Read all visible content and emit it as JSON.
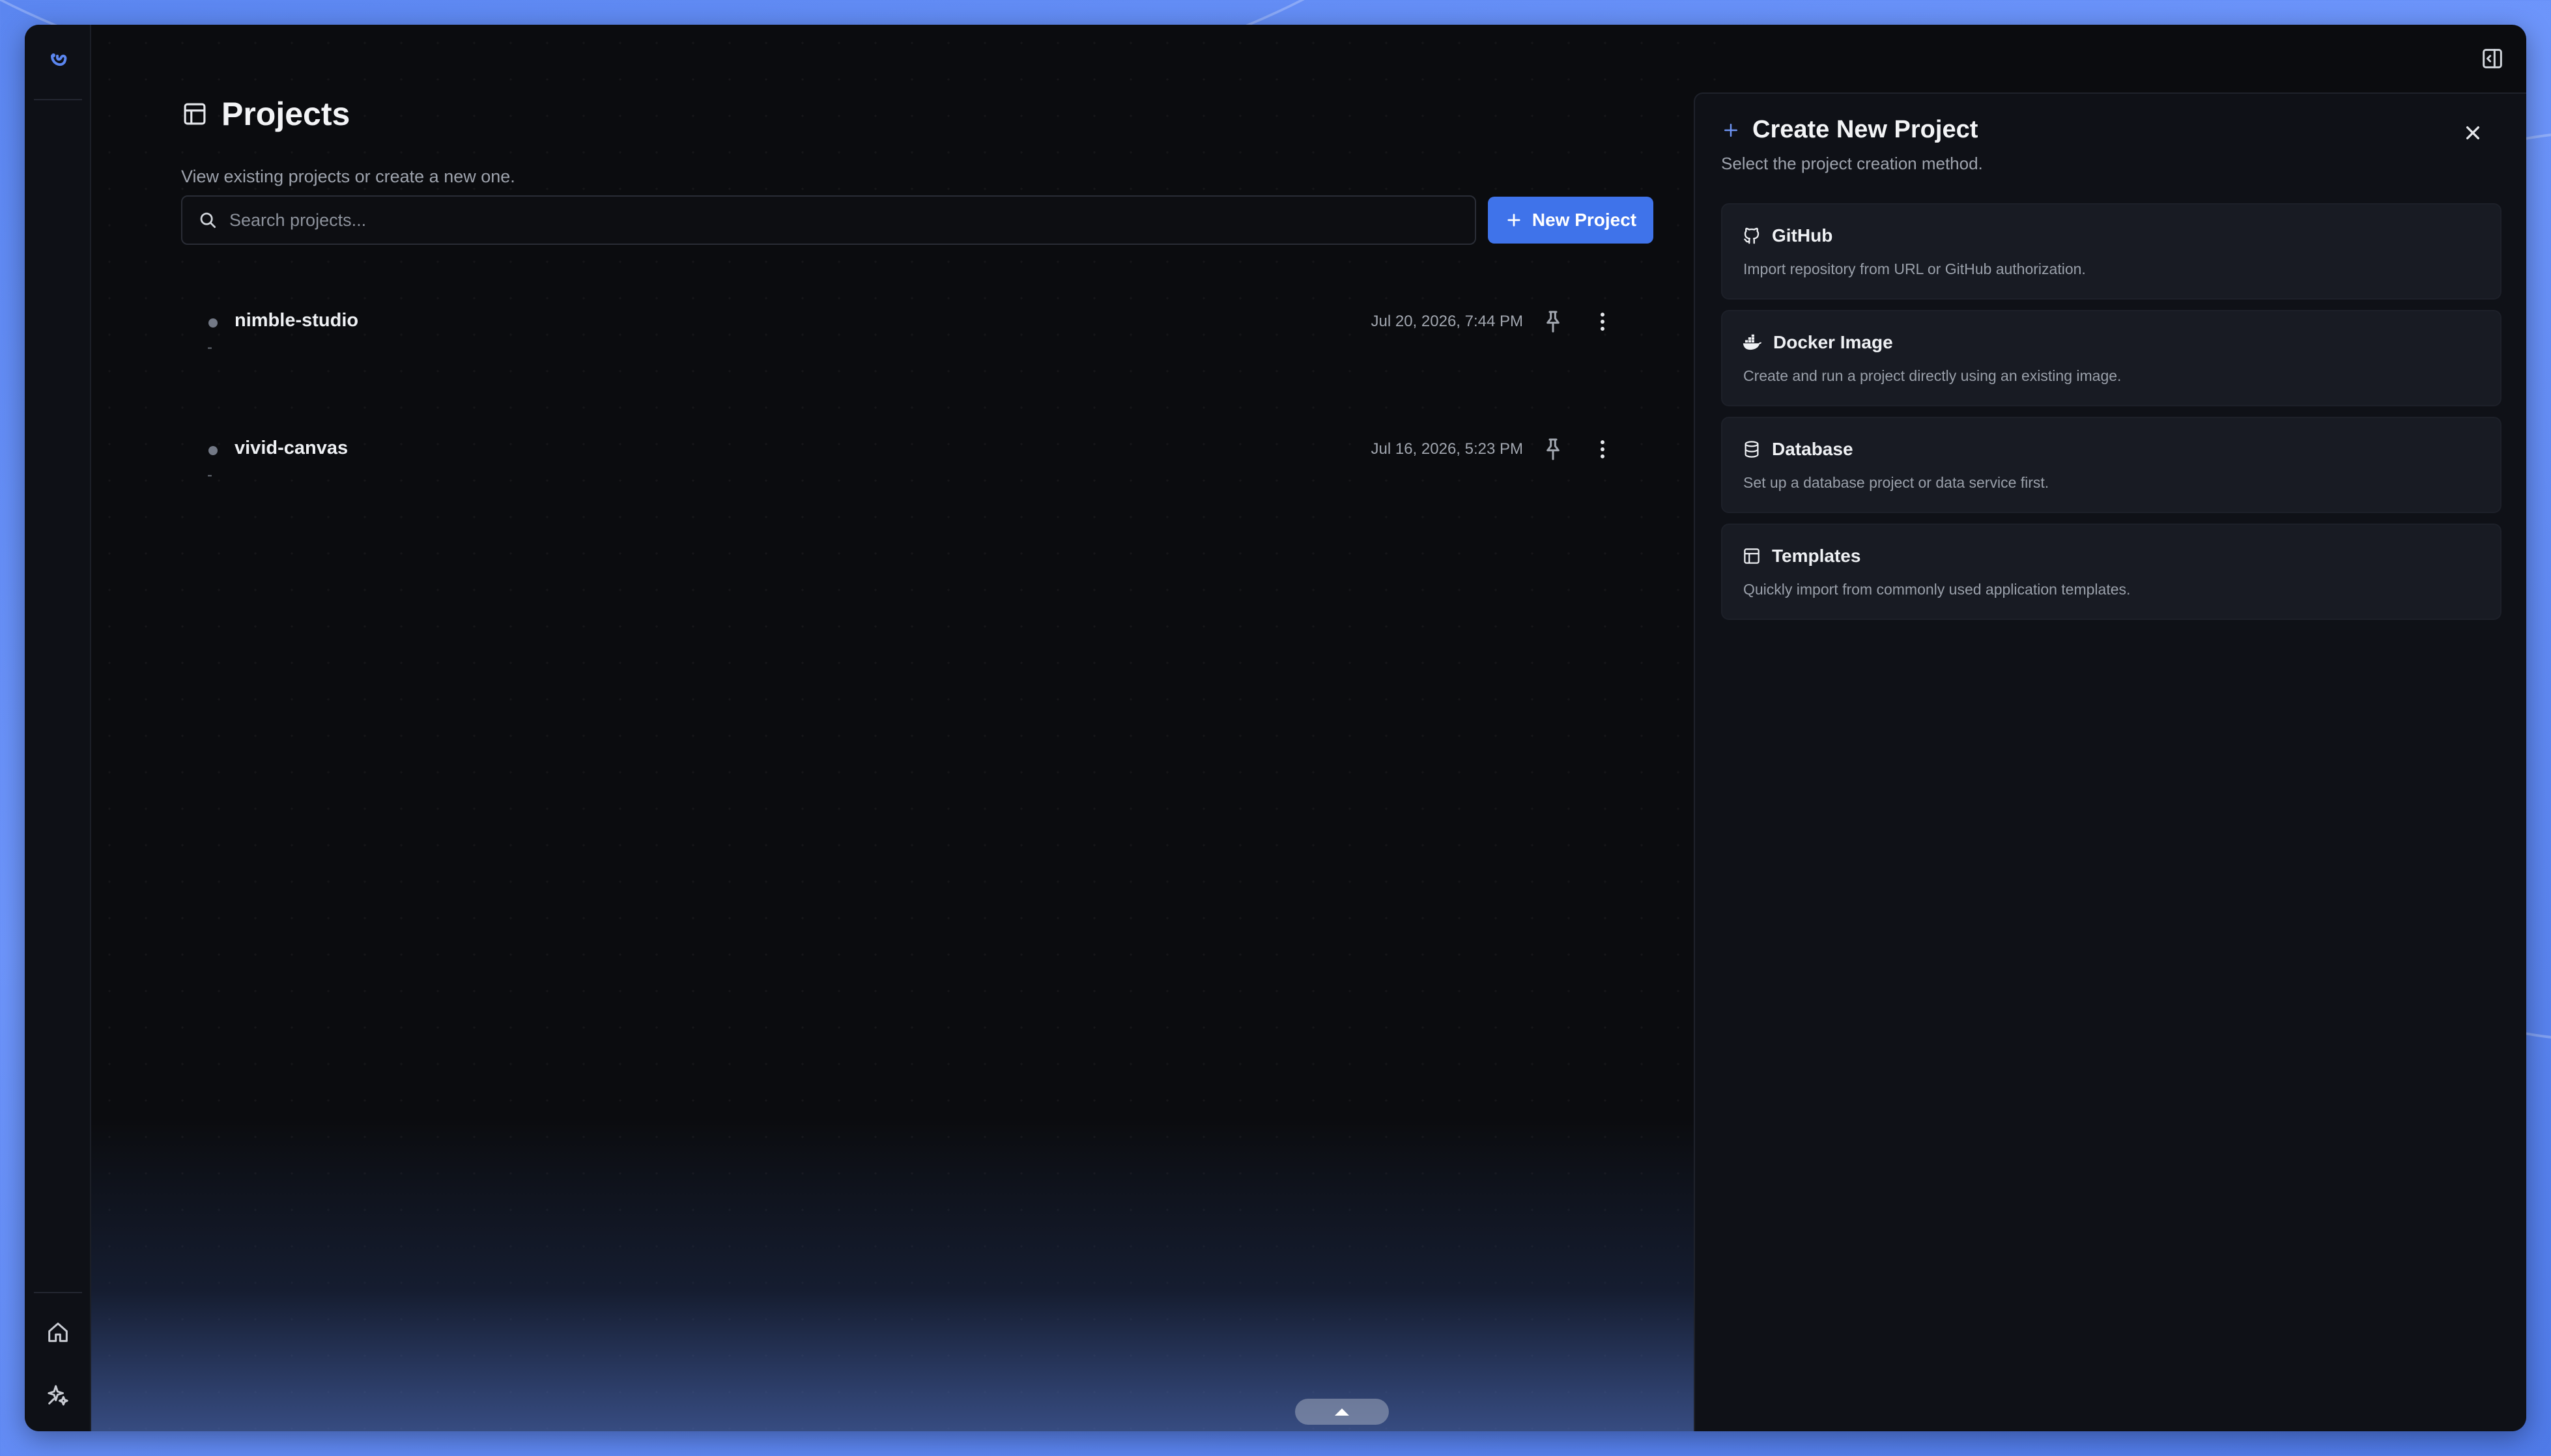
{
  "page": {
    "title": "Projects",
    "subtitle": "View existing projects or create a new one."
  },
  "search": {
    "placeholder": "Search projects..."
  },
  "new_project_button": {
    "label": "New Project"
  },
  "projects": [
    {
      "name": "nimble-studio",
      "description": "-",
      "timestamp": "Jul 20, 2026, 7:44 PM"
    },
    {
      "name": "vivid-canvas",
      "description": "-",
      "timestamp": "Jul 16, 2026, 5:23 PM"
    }
  ],
  "create_panel": {
    "title": "Create New Project",
    "subtitle": "Select the project creation method.",
    "options": [
      {
        "label": "GitHub",
        "description": "Import repository from URL or GitHub authorization.",
        "icon": "github-icon"
      },
      {
        "label": "Docker Image",
        "description": "Create and run a project directly using an existing image.",
        "icon": "docker-icon"
      },
      {
        "label": "Database",
        "description": "Set up a database project or data service first.",
        "icon": "database-icon"
      },
      {
        "label": "Templates",
        "description": "Quickly import from commonly used application templates.",
        "icon": "template-icon"
      }
    ]
  },
  "sidebar": {
    "icons": [
      "logo-icon",
      "home-icon",
      "sparkle-icon"
    ]
  },
  "colors": {
    "accent": "#3f73ea",
    "background": "#0b0c0f",
    "panel": "#0f1117",
    "card": "#181b23"
  }
}
